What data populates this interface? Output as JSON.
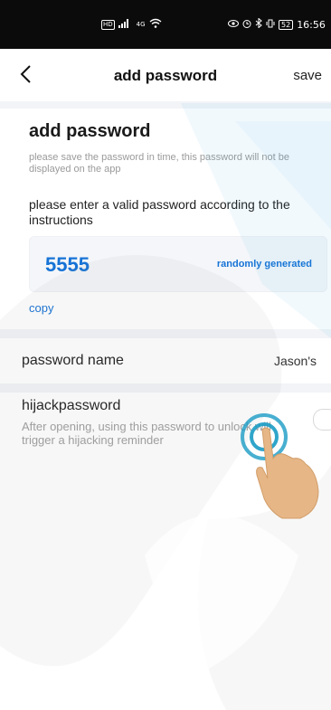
{
  "status_bar": {
    "left_badge": "HD",
    "signal_text": "4G",
    "battery": "52",
    "time": "16:56"
  },
  "nav": {
    "back_icon": "chevron-left-icon",
    "title": "add password",
    "save_label": "save"
  },
  "password_section": {
    "title": "add password",
    "hint": "please save the password in time, this password will not be displayed on the app",
    "instruction": "please enter a valid password according to the instructions",
    "password_value": "5555",
    "random_label": "randomly generated",
    "copy_label": "copy"
  },
  "password_name": {
    "label": "password name",
    "value": "Jason's"
  },
  "hijack": {
    "label": "hijackpassword",
    "description": "After opening, using this password to unlock will trigger a hijacking reminder",
    "enabled": false
  },
  "colors": {
    "accent": "#1673d6",
    "status_bar": "#0b0b0b",
    "section_gap": "#f2f4f7"
  }
}
